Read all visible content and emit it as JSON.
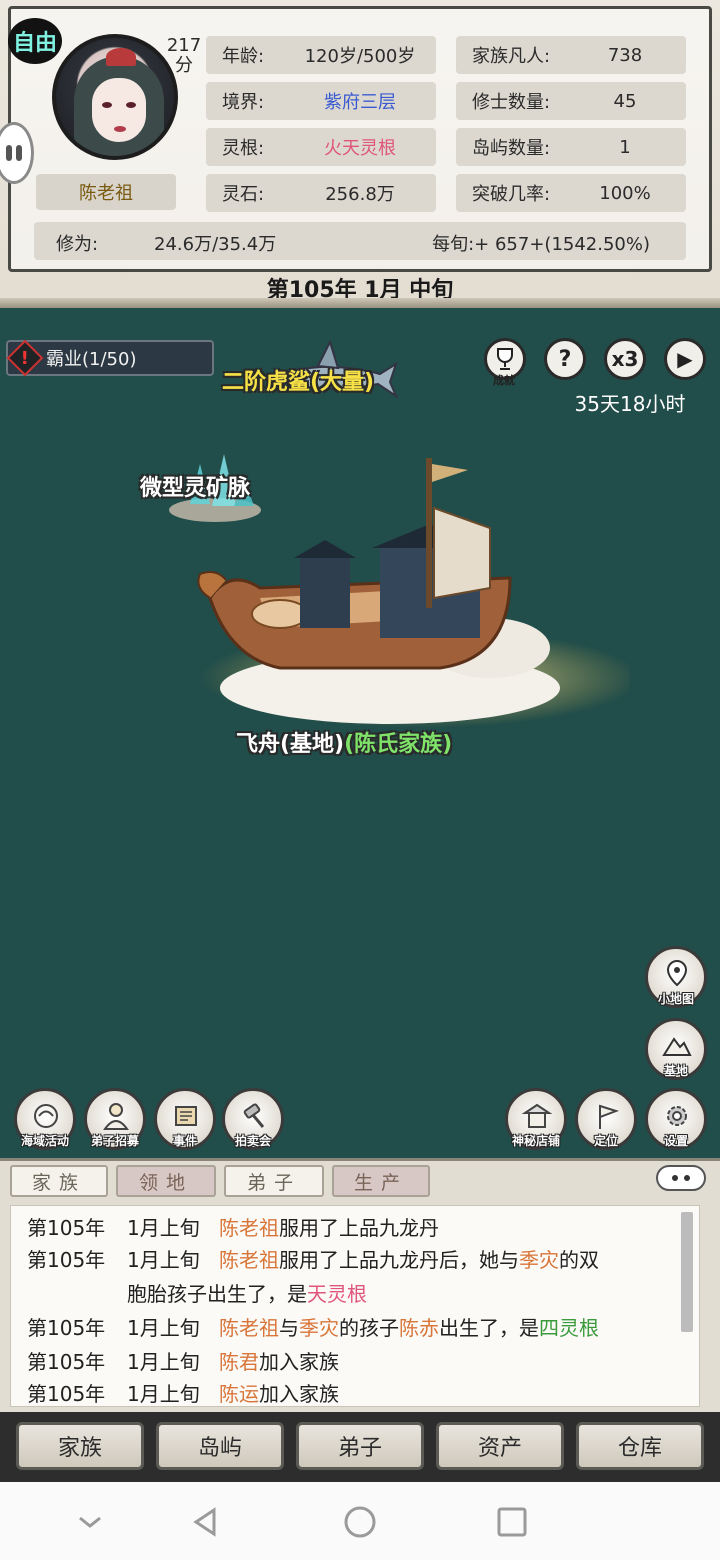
{
  "header": {
    "free_badge": "自由",
    "score": "217\n分",
    "character_name": "陈老祖",
    "stats_left": [
      {
        "label": "年龄:",
        "value": "120岁/500岁",
        "color": "#2b2b2b"
      },
      {
        "label": "境界:",
        "value": "紫府三层",
        "color": "#3a5bd0"
      },
      {
        "label": "灵根:",
        "value": "火天灵根",
        "color": "#e0557a"
      },
      {
        "label": "灵石:",
        "value": "256.8万",
        "color": "#2b2b2b"
      }
    ],
    "stats_right": [
      {
        "label": "家族凡人:",
        "value": "738"
      },
      {
        "label": "修士数量:",
        "value": "45"
      },
      {
        "label": "岛屿数量:",
        "value": "1"
      },
      {
        "label": "突破几率:",
        "value": "100%"
      }
    ],
    "cultivation": {
      "label": "修为:",
      "value": "24.6万/35.4万",
      "rate": "每旬:+ 657+(1542.50%)"
    },
    "date": "第105年 1月 中旬"
  },
  "map": {
    "dominion": "霸业(1/50)",
    "controls": {
      "achievement_label": "成就",
      "help_glyph": "?",
      "speed": "x3",
      "play_glyph": "▶"
    },
    "timer": "35天18小时",
    "shark_label": "二阶虎鲨(大量)",
    "mine_label": "微型灵矿脉",
    "ship_label": "飞舟(基地)",
    "ship_family": "(陈氏家族)",
    "left_buttons": [
      "海域活动",
      "弟子招募",
      "事件",
      "拍卖会"
    ],
    "right_buttons": [
      "神秘店铺",
      "定位",
      "设置"
    ],
    "side_buttons": [
      "小地图",
      "基地"
    ]
  },
  "log": {
    "tabs": [
      "家族",
      "领地",
      "弟子",
      "生产"
    ],
    "lines": [
      [
        {
          "t": "第105年"
        },
        {
          "t": "1月上旬"
        },
        {
          "t": "陈老祖",
          "c": "or"
        },
        {
          "t": "服用了上品九龙丹"
        }
      ],
      [
        {
          "t": "第105年"
        },
        {
          "t": "1月上旬"
        },
        {
          "t": "陈老祖",
          "c": "or"
        },
        {
          "t": "服用了上品九龙丹后，她与"
        },
        {
          "t": "季灾",
          "c": "or"
        },
        {
          "t": "的双"
        }
      ],
      [
        {
          "t": ""
        },
        {
          "t": "胞胎孩子出生了，是"
        },
        {
          "t": "天灵根",
          "c": "pk"
        }
      ],
      [
        {
          "t": "第105年"
        },
        {
          "t": "1月上旬"
        },
        {
          "t": "陈老祖",
          "c": "or"
        },
        {
          "t": "与"
        },
        {
          "t": "季灾",
          "c": "or"
        },
        {
          "t": "的孩子"
        },
        {
          "t": "陈赤",
          "c": "or"
        },
        {
          "t": "出生了，是"
        },
        {
          "t": "四灵根",
          "c": "gr"
        }
      ],
      [
        {
          "t": "第105年"
        },
        {
          "t": "1月上旬"
        },
        {
          "t": "陈君",
          "c": "or"
        },
        {
          "t": "加入家族"
        }
      ],
      [
        {
          "t": "第105年"
        },
        {
          "t": "1月上旬"
        },
        {
          "t": "陈运",
          "c": "or"
        },
        {
          "t": "加入家族"
        }
      ]
    ]
  },
  "nav": [
    "家族",
    "岛屿",
    "弟子",
    "资产",
    "仓库"
  ],
  "colors": {
    "sea": "#214d4a",
    "parchment": "#e3ddd1",
    "highlight_name": "#d8763a",
    "highlight_root": "#e0557a",
    "highlight_good": "#3b9a3b"
  }
}
